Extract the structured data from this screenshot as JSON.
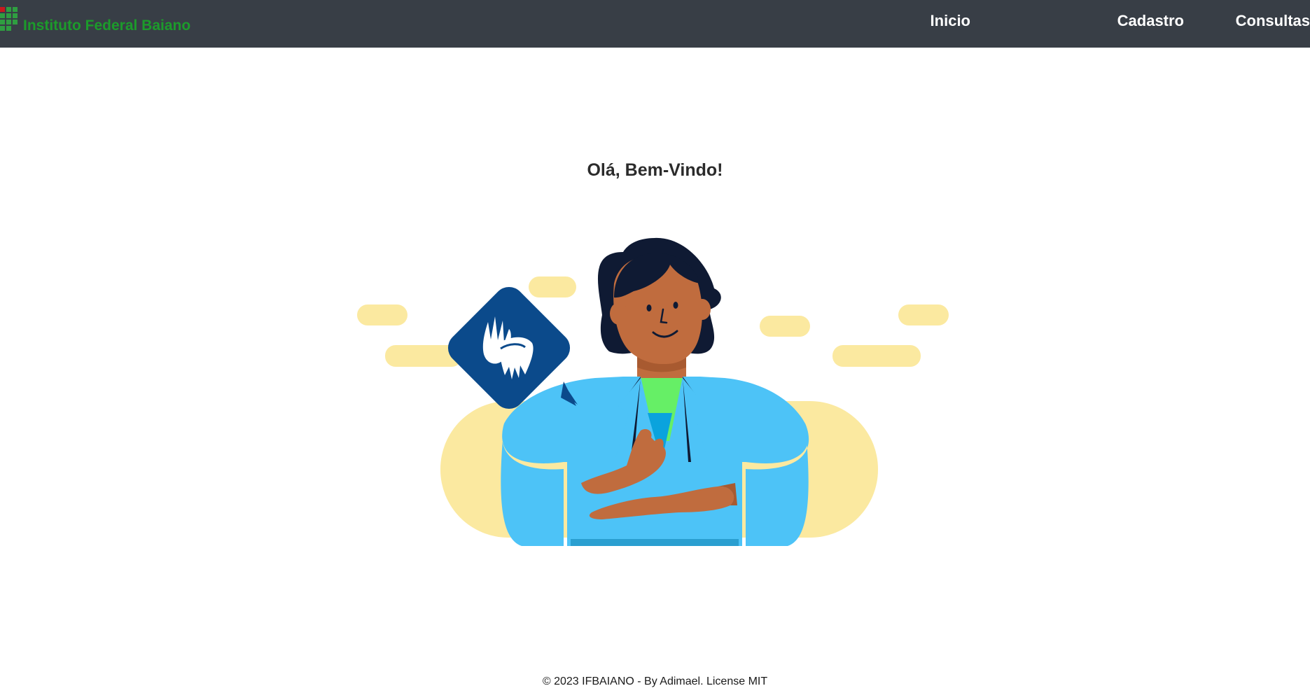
{
  "navbar": {
    "brand_name": "Instituto Federal Baiano",
    "links": [
      {
        "label": "Inicio"
      },
      {
        "label": "Cadastro"
      },
      {
        "label": "Consultas"
      }
    ]
  },
  "main": {
    "welcome_title": "Olá, Bem-Vindo!",
    "illustration_icon": "sign-language-hands-icon"
  },
  "footer": {
    "text": "© 2023 IFBAIANO - By Adimael. License MIT"
  },
  "colors": {
    "navbar_bg": "#383e46",
    "brand_green": "#1c9b2b",
    "brand_red": "#c8191e",
    "sign_badge_blue": "#0b4a8b",
    "blob_yellow": "#fbe9a0",
    "jacket_blue": "#4dc3f7",
    "shirt_green": "#66ef66"
  }
}
